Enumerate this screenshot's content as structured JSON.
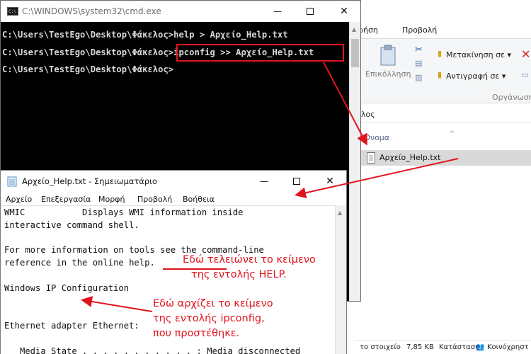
{
  "cmd": {
    "title": "C:\\WINDOWS\\system32\\cmd.exe",
    "lines": [
      "C:\\Users\\TestEgo\\Desktop\\Φάκελος>help > Αρχείο_Help.txt",
      "C:\\Users\\TestEgo\\Desktop\\Φάκελος>ipconfig >> Αρχείο_Help.txt",
      "C:\\Users\\TestEgo\\Desktop\\Φάκελος>"
    ]
  },
  "explorer": {
    "tabs": [
      "ρήση",
      "Προβολή"
    ],
    "ribbon": {
      "easy_access": "Επικόλληση",
      "move_to": "Μετακίνηση σε ▾",
      "copy_to": "Αντιγραφή σε ▾",
      "organize": "Οργάνωση"
    },
    "address": "λος",
    "column_name": "Όνομα",
    "file_name": "Αρχείο_Help.txt",
    "status": {
      "items": "το στοιχείο",
      "size": "7,85 KB",
      "state_label": "Κατάσταση:",
      "state_value": "Κοινόχρηστ"
    }
  },
  "notepad": {
    "title": "Αρχείο_Help.txt - Σημειωματάριο",
    "menu": [
      "Αρχείο",
      "Επεξεργασία",
      "Μορφή",
      "Προβολή",
      "Βοήθεια"
    ],
    "lines": [
      "WMIC           Displays WMI information inside",
      "interactive command shell.",
      "",
      "For more information on tools see the command-line",
      "reference in the online help.",
      "",
      "Windows IP Configuration",
      "",
      "",
      "Ethernet adapter Ethernet:",
      "",
      "   Media State . . . . . . . . . . . : Media disconnected"
    ]
  },
  "annotations": {
    "help_end": [
      "Εδώ τελειώνει το κείμενο",
      "της εντολής HELP."
    ],
    "ipconfig_start": [
      "Εδώ αρχίζει το κείμενο",
      "της εντολής ipconfig,",
      "που προστέθηκε."
    ]
  },
  "colors": {
    "accent_red": "#e0141e",
    "console_bg": "#000000",
    "console_fg": "#d8d8d8"
  }
}
